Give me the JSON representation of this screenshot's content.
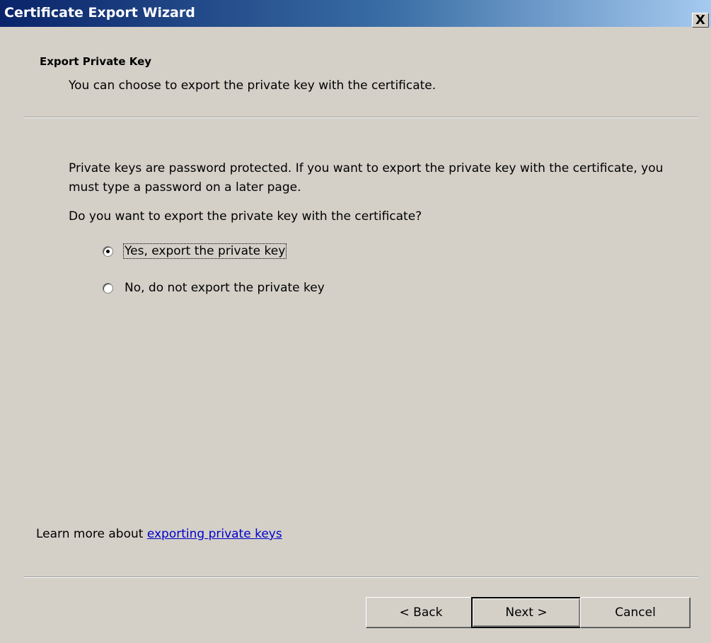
{
  "window": {
    "title": "Certificate Export Wizard",
    "close_glyph": "X"
  },
  "header": {
    "title": "Export Private Key",
    "description": "You can choose to export the private key with the certificate."
  },
  "body": {
    "paragraph_1": "Private keys are password protected. If you want to export the private key with the certificate, you must type a password on a later page.",
    "question": "Do you want to export the private key with the certificate?"
  },
  "options": [
    {
      "label": "Yes, export the private key",
      "selected": true
    },
    {
      "label": "No, do not export the private key",
      "selected": false
    }
  ],
  "learn_more": {
    "prefix": "Learn more about ",
    "link": "exporting private keys"
  },
  "buttons": {
    "back": "< Back",
    "next": "Next >",
    "cancel": "Cancel"
  },
  "colors": {
    "dialog_bg": "#d4d0c8",
    "titlebar_start": "#0a246a",
    "titlebar_end": "#a6caf0",
    "link": "#0000cc"
  }
}
